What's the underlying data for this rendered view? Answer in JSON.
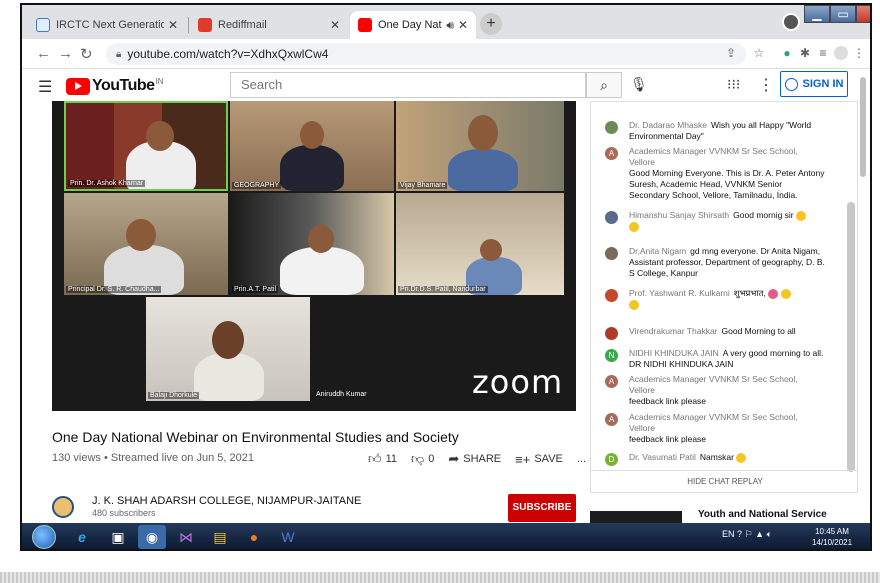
{
  "browser": {
    "tabs": [
      {
        "label": "IRCTC Next Generation eTicketin",
        "close": "✕"
      },
      {
        "label": "Rediffmail",
        "close": "✕"
      },
      {
        "label": "One Day National Webinar o",
        "close": "✕",
        "active": true
      }
    ],
    "url": "youtube.com/watch?v=XdhxQxwlCw4",
    "new_tab": "+"
  },
  "youtube": {
    "logo_word": "YouTube",
    "logo_country": "IN",
    "search_placeholder": "Search",
    "sign_in": "SIGN IN"
  },
  "video": {
    "participants": [
      "Prin. Dr. Ashok Kharnar",
      "GEOGRAPHY",
      "Vijay Bhamare",
      "Principal Dr. S. R. Chaudha...",
      "Prin.A.T. Patil",
      "Pri.Dr.D.S. Patil, Nandurbar",
      "Balaji Dhorkule",
      "Aniruddh Kumar"
    ],
    "zoom_logo": "zoom",
    "title": "One Day National Webinar on Environmental Studies and Society",
    "meta": "130 views • Streamed live on Jun 5, 2021",
    "likes": "11",
    "dislikes": "0",
    "share": "SHARE",
    "save": "SAVE",
    "more": "..."
  },
  "channel": {
    "name": "J. K. SHAH ADARSH COLLEGE, NIJAMPUR-JAITANE",
    "subscribers": "480 subscribers",
    "subscribe": "SUBSCRIBE"
  },
  "chat": {
    "messages": [
      {
        "author": "Dr. Dadarao Mhaske",
        "text": "Wish you all Happy \"World Environmental Day\"",
        "initial": ""
      },
      {
        "author": "Academics Manager VVNKM Sr Sec School, Vellore",
        "text": "Good Morning Everyone. This is Dr. A. Peter Antony Suresh, Academic Head, VVNKM Senior Secondary School, Vellore, Tamilnadu, India.",
        "initial": "A"
      },
      {
        "author": "Himanshu Sanjay Shirsath",
        "text": "Good mornig sir",
        "initial": ""
      },
      {
        "author": "Dr.Anita Nigam",
        "text": "gd mng everyone. Dr Anita Nigam, Assistant professor, Department of geography, D. B. S College, Kanpur",
        "initial": ""
      },
      {
        "author": "Prof. Yashwant R. Kulkarni",
        "text": "शुभप्रभात,",
        "initial": ""
      },
      {
        "author": "Virendrakumar Thakkar",
        "text": "Good Morning to all",
        "initial": ""
      },
      {
        "author": "NIDHI KHINDUKA JAIN",
        "text": "A very good morning to all. DR NIDHI KHINDUKA JAIN",
        "initial": "N"
      },
      {
        "author": "Academics Manager VVNKM Sr Sec School, Vellore",
        "text": "feedback link please",
        "initial": "A"
      },
      {
        "author": "Academics Manager VVNKM Sr Sec School, Vellore",
        "text": "feedback link please",
        "initial": "A"
      },
      {
        "author": "Dr. Vasumati Patil",
        "text": "Namskar",
        "initial": "D"
      }
    ],
    "hide_chat": "HIDE CHAT REPLAY"
  },
  "sidebar": {
    "next_title": "Youth and National Service"
  },
  "taskbar": {
    "lang": "EN",
    "time": "10:45 AM",
    "date": "14/10/2021"
  }
}
